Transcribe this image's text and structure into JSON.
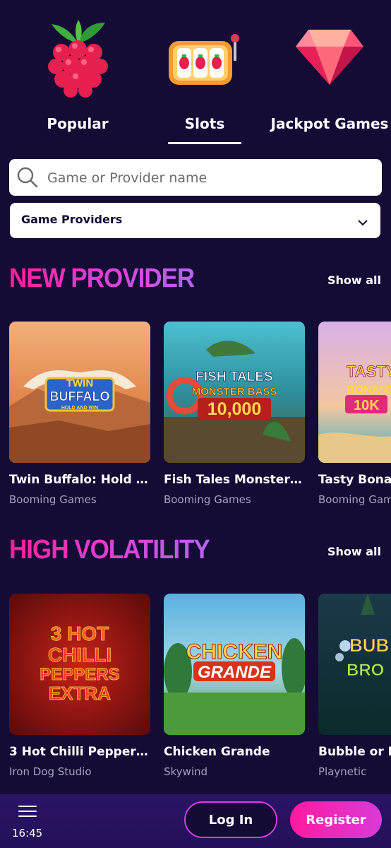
{
  "categories": [
    {
      "label": "Popular",
      "icon": "raspberry-icon"
    },
    {
      "label": "Slots",
      "icon": "slot-machine-icon",
      "active": true
    },
    {
      "label": "Jackpot Games",
      "icon": "diamond-icon"
    }
  ],
  "search": {
    "placeholder": "Game or Provider name"
  },
  "provider_filter": {
    "selected": "Game Providers"
  },
  "sections": [
    {
      "title": "NEW PROVIDER",
      "show_all": "Show all",
      "games": [
        {
          "title": "Twin Buffalo: Hold & ...",
          "provider": "Booming Games",
          "art_text": [
            "TWIN",
            "BUFFALO",
            "HOLD AND WIN"
          ]
        },
        {
          "title": "Fish Tales Monster B...",
          "provider": "Booming Games",
          "art_text": [
            "FISH TALES",
            "MONSTER BASS",
            "10,000"
          ]
        },
        {
          "title": "Tasty Bonanza",
          "provider": "Booming Games",
          "art_text": [
            "TASTY",
            "BONANZA",
            "10K"
          ]
        }
      ]
    },
    {
      "title": "HIGH VOLATILITY",
      "show_all": "Show all",
      "games": [
        {
          "title": "3 Hot Chilli Peppers ...",
          "provider": "Iron Dog Studio",
          "art_text": [
            "3 HOT",
            "CHILLI",
            "PEPPERS",
            "EXTRA"
          ]
        },
        {
          "title": "Chicken Grande",
          "provider": "Skywind",
          "art_text": [
            "CHICKEN",
            "GRANDE"
          ]
        },
        {
          "title": "Bubble or Broom",
          "provider": "Playnetic",
          "art_text": [
            "BUB",
            "BRO"
          ]
        }
      ]
    }
  ],
  "bottom_bar": {
    "time": "16:45",
    "login": "Log In",
    "register": "Register"
  },
  "colors": {
    "background": "#140c35",
    "accent_pink": "#ff1aa0",
    "accent_purple": "#b565f0"
  }
}
